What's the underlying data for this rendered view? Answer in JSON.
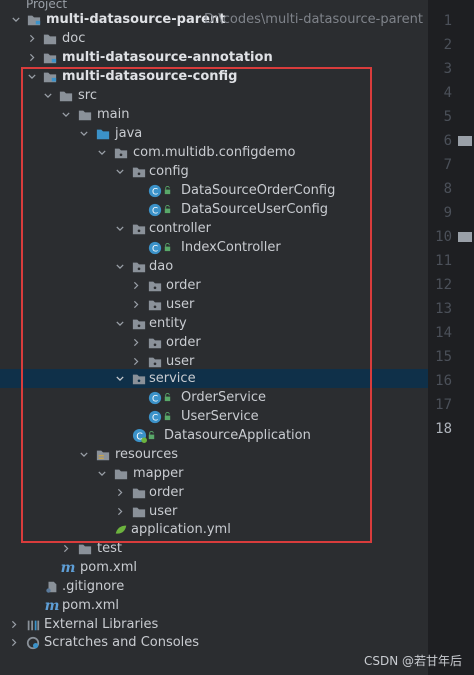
{
  "header_partial": "Project",
  "tree": [
    {
      "label": "multi-datasource-parent",
      "path": "D:\\codes\\multi-datasource-parent",
      "bold": true
    },
    {
      "label": "doc"
    },
    {
      "label": "multi-datasource-annotation",
      "bold": true
    },
    {
      "label": "multi-datasource-config",
      "bold": true
    },
    {
      "label": "src"
    },
    {
      "label": "main"
    },
    {
      "label": "java"
    },
    {
      "label": "com.multidb.configdemo"
    },
    {
      "label": "config"
    },
    {
      "label": "DataSourceOrderConfig"
    },
    {
      "label": "DataSourceUserConfig"
    },
    {
      "label": "controller"
    },
    {
      "label": "IndexController"
    },
    {
      "label": "dao"
    },
    {
      "label": "order"
    },
    {
      "label": "user"
    },
    {
      "label": "entity"
    },
    {
      "label": "order"
    },
    {
      "label": "user"
    },
    {
      "label": "service"
    },
    {
      "label": "OrderService"
    },
    {
      "label": "UserService"
    },
    {
      "label": "DatasourceApplication"
    },
    {
      "label": "resources"
    },
    {
      "label": "mapper"
    },
    {
      "label": "order"
    },
    {
      "label": "user"
    },
    {
      "label": "application.yml"
    },
    {
      "label": "test"
    },
    {
      "label": "pom.xml"
    },
    {
      "label": ".gitignore"
    },
    {
      "label": "pom.xml"
    },
    {
      "label": "External Libraries"
    },
    {
      "label": "Scratches and Consoles"
    }
  ],
  "line_numbers": [
    "1",
    "2",
    "3",
    "4",
    "5",
    "6",
    "7",
    "8",
    "9",
    "10",
    "11",
    "12",
    "13",
    "14",
    "15",
    "16",
    "17",
    "18"
  ],
  "active_line": "18",
  "watermark": "CSDN @若甘年后",
  "colors": {
    "folder": "#8a9199",
    "class_icon": "#3b92c9",
    "selection": "#0f3049",
    "highlight_box": "#d93c3c"
  }
}
